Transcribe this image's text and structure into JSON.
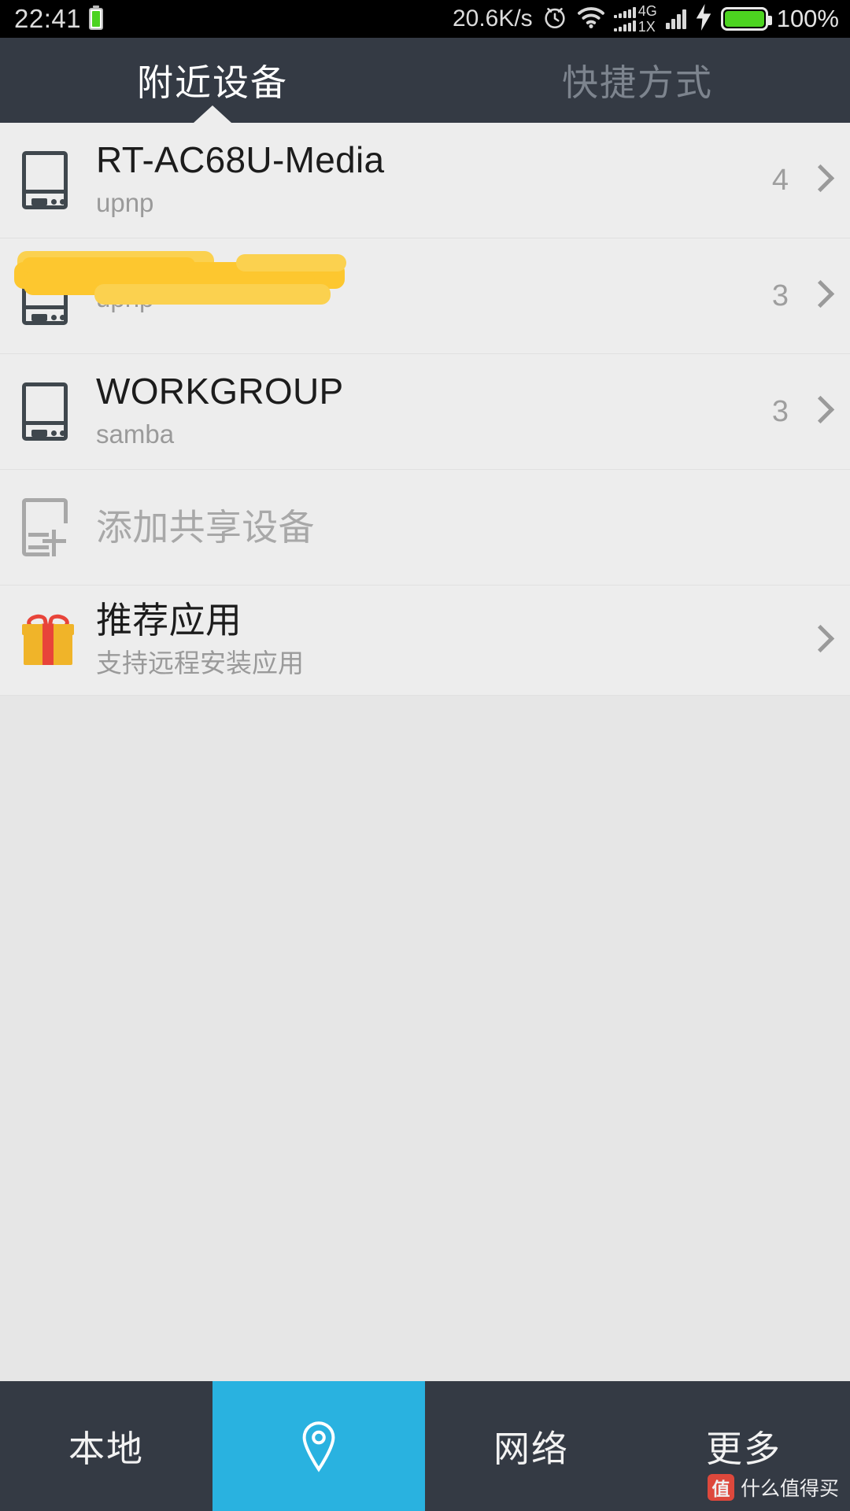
{
  "status_bar": {
    "time": "22:41",
    "net_speed": "20.6K/s",
    "sim1_generation": "4G",
    "sim2_generation": "1X",
    "battery_percent": "100%",
    "icons": [
      "battery-small-icon",
      "alarm-clock-icon",
      "wifi-icon",
      "signal-bars-icon",
      "charging-bolt-icon",
      "battery-icon"
    ],
    "background_color": "#000000"
  },
  "tabs": [
    {
      "label": "附近设备",
      "active": true
    },
    {
      "label": "快捷方式",
      "active": false
    }
  ],
  "tab_bar": {
    "background_color": "#343a44",
    "active_color": "#ffffff",
    "inactive_color": "#7d848e"
  },
  "devices": [
    {
      "name": "RT-AC68U-Media",
      "protocol": "upnp",
      "count": "4",
      "redacted": false
    },
    {
      "name": "",
      "protocol": "upnp",
      "count": "3",
      "redacted": true
    },
    {
      "name": "WORKGROUP",
      "protocol": "samba",
      "count": "3",
      "redacted": false
    }
  ],
  "actions": {
    "add_shared_device": {
      "label": "添加共享设备",
      "icon": "add-device-icon"
    },
    "recommended_apps": {
      "label": "推荐应用",
      "subtitle": "支持远程安装应用",
      "icon": "gift-icon"
    }
  },
  "bottom_nav": [
    {
      "label": "本地",
      "icon": "",
      "active": false
    },
    {
      "label": "",
      "icon": "location-pin-icon",
      "active": true
    },
    {
      "label": "网络",
      "icon": "",
      "active": false
    },
    {
      "label": "更多",
      "icon": "",
      "active": false
    }
  ],
  "bottom_nav_style": {
    "background_color": "#343a44",
    "active_color": "#29b2e0"
  },
  "watermark": {
    "badge": "值",
    "text": "什么值得买"
  },
  "colors": {
    "list_background": "#ededed",
    "page_background": "#e6e6e6",
    "redaction_yellow": "#fdc72f",
    "device_icon": "#3f474d",
    "muted_text": "#9a9a9a"
  }
}
